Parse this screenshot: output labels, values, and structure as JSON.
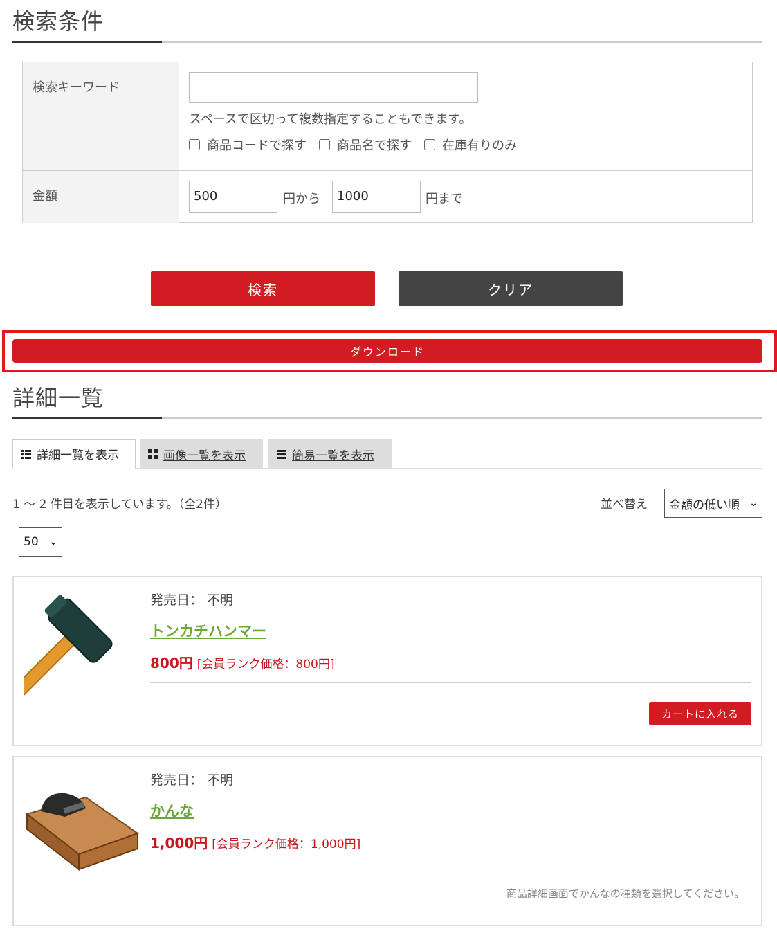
{
  "search": {
    "title": "検索条件",
    "keyword_label": "検索キーワード",
    "keyword_value": "",
    "hint": "スペースで区切って複数指定することもできます。",
    "checks": [
      "商品コードで探す",
      "商品名で探す",
      "在庫有りのみ"
    ],
    "price_label": "金額",
    "price_from": "500",
    "price_from_suffix": "円から",
    "price_to": "1000",
    "price_to_suffix": "円まで",
    "search_button": "検索",
    "clear_button": "クリア"
  },
  "download_button": "ダウンロード",
  "list": {
    "title": "詳細一覧",
    "tabs": [
      "詳細一覧を表示",
      "画像一覧を表示",
      "簡易一覧を表示"
    ],
    "count_text": "1 ～ 2 件目を表示しています。（全2件）",
    "sort_label": "並べ替え",
    "sort_value": "金額の低い順",
    "per_page": "50"
  },
  "products": [
    {
      "release": "発売日： 不明",
      "name": "トンカチハンマー",
      "price": "800円",
      "rank_price": "[会員ランク価格：800円]",
      "cart": "カートに入れる",
      "icon": "hammer-image"
    },
    {
      "release": "発売日： 不明",
      "name": "かんな",
      "price": "1,000円",
      "rank_price": "[会員ランク価格：1,000円]",
      "note": "商品詳細画面でかんなの種類を選択してください。",
      "icon": "plane-image"
    }
  ],
  "colors": {
    "accent_red": "#d21c21",
    "dark_gray": "#444444",
    "link_green": "#6aa83a",
    "highlight_frame": "#e4161b"
  }
}
